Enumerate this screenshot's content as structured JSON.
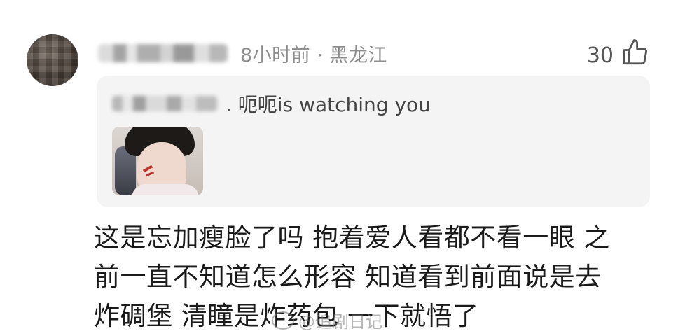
{
  "comment": {
    "username_obscured": true,
    "meta": "8小时前 · 黑龙江",
    "like_count": "30",
    "reply": {
      "text": ". 呃呃is watching you"
    },
    "body_lines": [
      "这是忘加瘦脸了吗 抱着爱人看都不看一眼 之",
      "前一直不知道怎么形容 知道看到前面说是去",
      "炸碉堡 清瞳是炸药包 一下就悟了"
    ]
  },
  "watermark": {
    "text": "@追剧日记"
  }
}
